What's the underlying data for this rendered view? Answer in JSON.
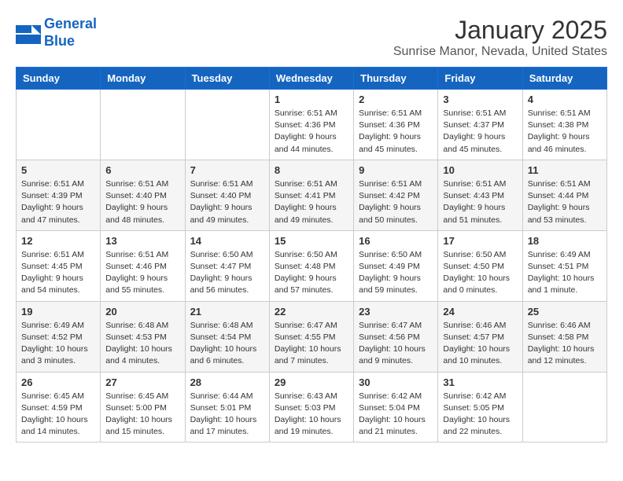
{
  "logo": {
    "line1": "General",
    "line2": "Blue"
  },
  "title": "January 2025",
  "subtitle": "Sunrise Manor, Nevada, United States",
  "days_of_week": [
    "Sunday",
    "Monday",
    "Tuesday",
    "Wednesday",
    "Thursday",
    "Friday",
    "Saturday"
  ],
  "weeks": [
    [
      {
        "day": "",
        "info": ""
      },
      {
        "day": "",
        "info": ""
      },
      {
        "day": "",
        "info": ""
      },
      {
        "day": "1",
        "info": "Sunrise: 6:51 AM\nSunset: 4:36 PM\nDaylight: 9 hours\nand 44 minutes."
      },
      {
        "day": "2",
        "info": "Sunrise: 6:51 AM\nSunset: 4:36 PM\nDaylight: 9 hours\nand 45 minutes."
      },
      {
        "day": "3",
        "info": "Sunrise: 6:51 AM\nSunset: 4:37 PM\nDaylight: 9 hours\nand 45 minutes."
      },
      {
        "day": "4",
        "info": "Sunrise: 6:51 AM\nSunset: 4:38 PM\nDaylight: 9 hours\nand 46 minutes."
      }
    ],
    [
      {
        "day": "5",
        "info": "Sunrise: 6:51 AM\nSunset: 4:39 PM\nDaylight: 9 hours\nand 47 minutes."
      },
      {
        "day": "6",
        "info": "Sunrise: 6:51 AM\nSunset: 4:40 PM\nDaylight: 9 hours\nand 48 minutes."
      },
      {
        "day": "7",
        "info": "Sunrise: 6:51 AM\nSunset: 4:40 PM\nDaylight: 9 hours\nand 49 minutes."
      },
      {
        "day": "8",
        "info": "Sunrise: 6:51 AM\nSunset: 4:41 PM\nDaylight: 9 hours\nand 49 minutes."
      },
      {
        "day": "9",
        "info": "Sunrise: 6:51 AM\nSunset: 4:42 PM\nDaylight: 9 hours\nand 50 minutes."
      },
      {
        "day": "10",
        "info": "Sunrise: 6:51 AM\nSunset: 4:43 PM\nDaylight: 9 hours\nand 51 minutes."
      },
      {
        "day": "11",
        "info": "Sunrise: 6:51 AM\nSunset: 4:44 PM\nDaylight: 9 hours\nand 53 minutes."
      }
    ],
    [
      {
        "day": "12",
        "info": "Sunrise: 6:51 AM\nSunset: 4:45 PM\nDaylight: 9 hours\nand 54 minutes."
      },
      {
        "day": "13",
        "info": "Sunrise: 6:51 AM\nSunset: 4:46 PM\nDaylight: 9 hours\nand 55 minutes."
      },
      {
        "day": "14",
        "info": "Sunrise: 6:50 AM\nSunset: 4:47 PM\nDaylight: 9 hours\nand 56 minutes."
      },
      {
        "day": "15",
        "info": "Sunrise: 6:50 AM\nSunset: 4:48 PM\nDaylight: 9 hours\nand 57 minutes."
      },
      {
        "day": "16",
        "info": "Sunrise: 6:50 AM\nSunset: 4:49 PM\nDaylight: 9 hours\nand 59 minutes."
      },
      {
        "day": "17",
        "info": "Sunrise: 6:50 AM\nSunset: 4:50 PM\nDaylight: 10 hours\nand 0 minutes."
      },
      {
        "day": "18",
        "info": "Sunrise: 6:49 AM\nSunset: 4:51 PM\nDaylight: 10 hours\nand 1 minute."
      }
    ],
    [
      {
        "day": "19",
        "info": "Sunrise: 6:49 AM\nSunset: 4:52 PM\nDaylight: 10 hours\nand 3 minutes."
      },
      {
        "day": "20",
        "info": "Sunrise: 6:48 AM\nSunset: 4:53 PM\nDaylight: 10 hours\nand 4 minutes."
      },
      {
        "day": "21",
        "info": "Sunrise: 6:48 AM\nSunset: 4:54 PM\nDaylight: 10 hours\nand 6 minutes."
      },
      {
        "day": "22",
        "info": "Sunrise: 6:47 AM\nSunset: 4:55 PM\nDaylight: 10 hours\nand 7 minutes."
      },
      {
        "day": "23",
        "info": "Sunrise: 6:47 AM\nSunset: 4:56 PM\nDaylight: 10 hours\nand 9 minutes."
      },
      {
        "day": "24",
        "info": "Sunrise: 6:46 AM\nSunset: 4:57 PM\nDaylight: 10 hours\nand 10 minutes."
      },
      {
        "day": "25",
        "info": "Sunrise: 6:46 AM\nSunset: 4:58 PM\nDaylight: 10 hours\nand 12 minutes."
      }
    ],
    [
      {
        "day": "26",
        "info": "Sunrise: 6:45 AM\nSunset: 4:59 PM\nDaylight: 10 hours\nand 14 minutes."
      },
      {
        "day": "27",
        "info": "Sunrise: 6:45 AM\nSunset: 5:00 PM\nDaylight: 10 hours\nand 15 minutes."
      },
      {
        "day": "28",
        "info": "Sunrise: 6:44 AM\nSunset: 5:01 PM\nDaylight: 10 hours\nand 17 minutes."
      },
      {
        "day": "29",
        "info": "Sunrise: 6:43 AM\nSunset: 5:03 PM\nDaylight: 10 hours\nand 19 minutes."
      },
      {
        "day": "30",
        "info": "Sunrise: 6:42 AM\nSunset: 5:04 PM\nDaylight: 10 hours\nand 21 minutes."
      },
      {
        "day": "31",
        "info": "Sunrise: 6:42 AM\nSunset: 5:05 PM\nDaylight: 10 hours\nand 22 minutes."
      },
      {
        "day": "",
        "info": ""
      }
    ]
  ]
}
